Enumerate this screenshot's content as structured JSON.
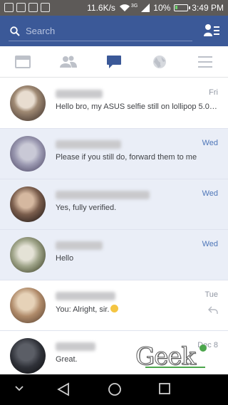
{
  "status_bar": {
    "network_speed": "11.6K/s",
    "network_type": "3G",
    "battery": "10%",
    "clock": "3:49 PM"
  },
  "search": {
    "placeholder": "Search"
  },
  "tabs": [
    {
      "name": "news-feed",
      "icon": "newsfeed-icon"
    },
    {
      "name": "friends",
      "icon": "friends-icon"
    },
    {
      "name": "messages",
      "icon": "chat-bubble-icon",
      "active": true
    },
    {
      "name": "notifications",
      "icon": "globe-icon"
    },
    {
      "name": "more",
      "icon": "menu-icon"
    }
  ],
  "conversations": [
    {
      "snippet": "Hello bro, my ASUS selfie still on lollipop 5.02....",
      "time": "Fri",
      "unread": false
    },
    {
      "snippet": "Please if you still do, forward them to me",
      "time": "Wed",
      "unread": true
    },
    {
      "snippet": "Yes, fully verified.",
      "time": "Wed",
      "unread": true
    },
    {
      "snippet": "Hello",
      "time": "Wed",
      "unread": true
    },
    {
      "snippet": "You: Alright, sir.",
      "time": "Tue",
      "unread": false,
      "emoji": "smiley"
    },
    {
      "snippet": "Great.",
      "time": "Dec 8",
      "unread": false
    }
  ],
  "watermark": "Geek",
  "colors": {
    "brand": "#3b5998",
    "unread_bg": "#eaeef7",
    "unread_time": "#4e76b8"
  }
}
